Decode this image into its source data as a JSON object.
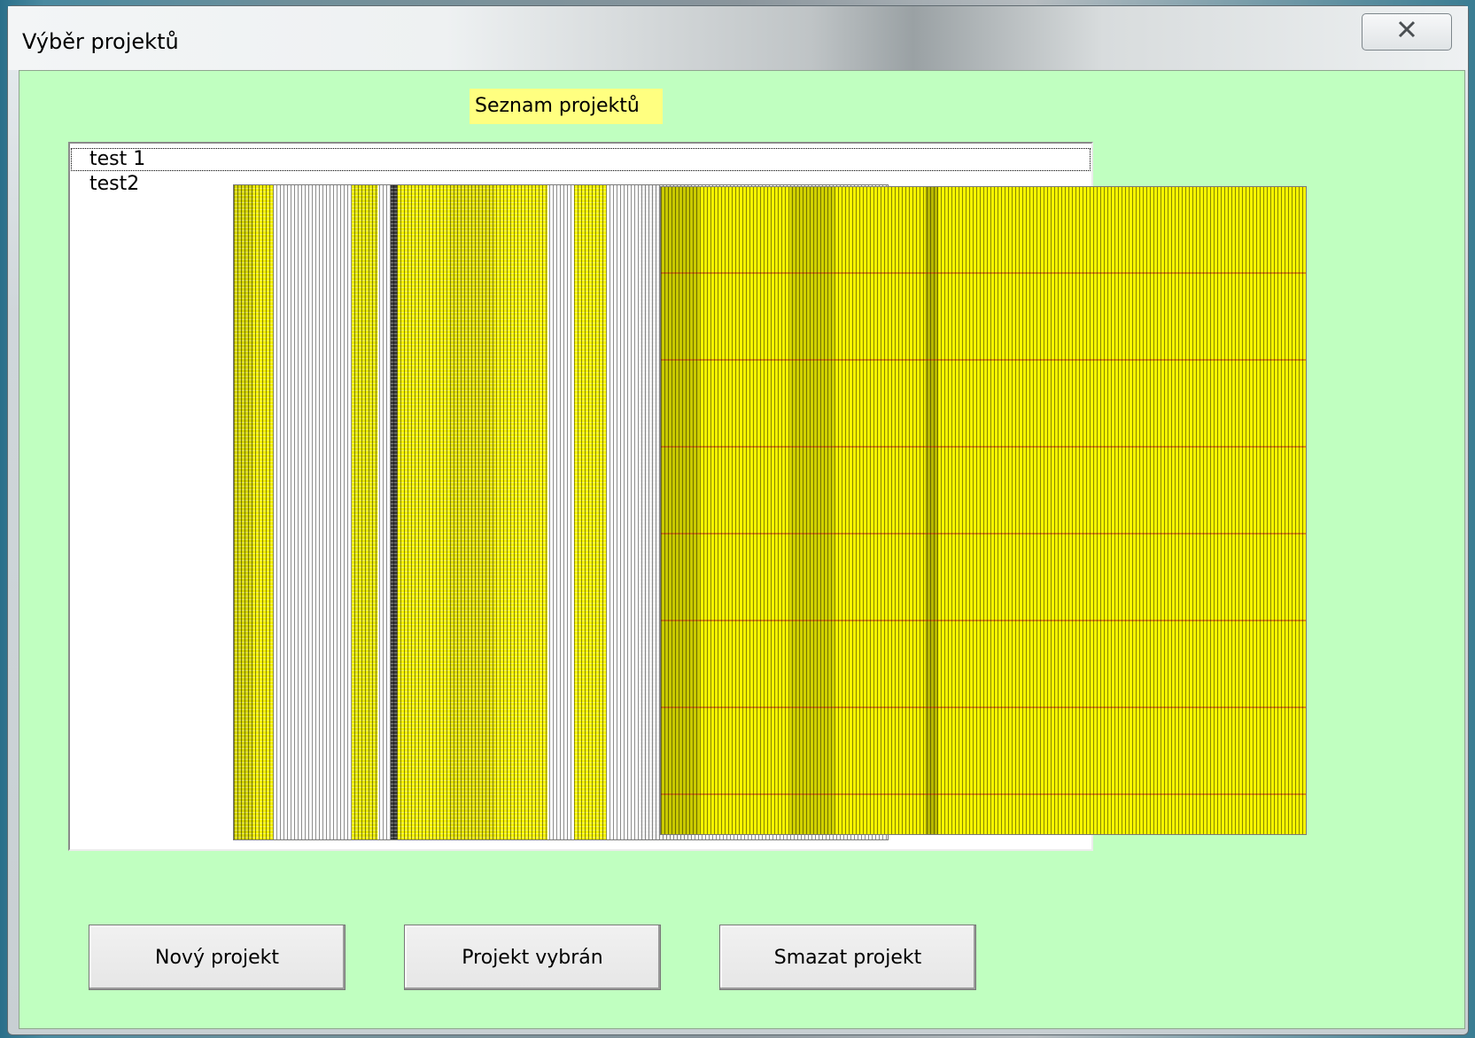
{
  "window": {
    "title": "Výběr projektů",
    "close_icon": "close-icon"
  },
  "list": {
    "label": "Seznam projektů",
    "items": [
      "test 1",
      "test2"
    ],
    "selected_index": 0
  },
  "buttons": {
    "new_project": "Nový projekt",
    "project_selected": "Projekt vybrán",
    "delete_project": "Smazat projekt"
  }
}
